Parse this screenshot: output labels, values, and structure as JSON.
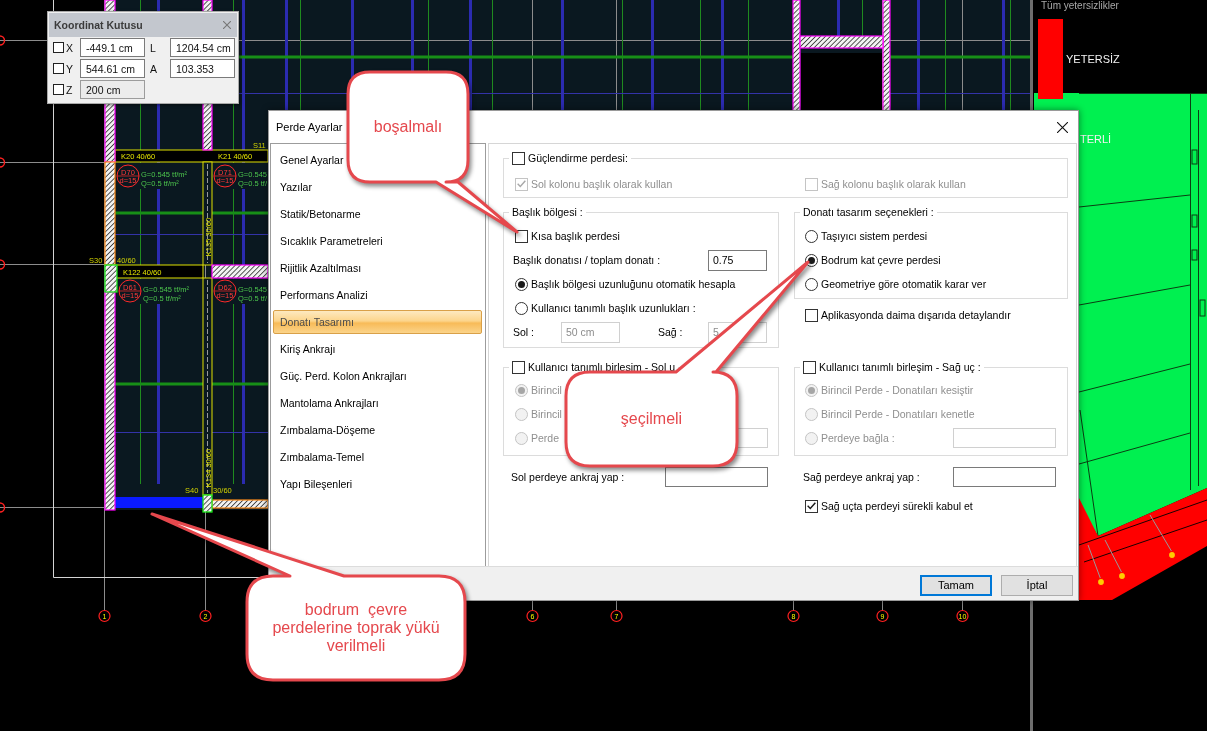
{
  "floor_plan": {
    "labels": [
      {
        "kind": "tag",
        "text": "S11"
      },
      {
        "kind": "beam",
        "text": "K20  40/60"
      },
      {
        "kind": "beam",
        "text": "K21  40/60"
      },
      {
        "kind": "load",
        "text": "G=0.545 tf/m²"
      },
      {
        "kind": "load",
        "text": "Q=0.5 tf/m²"
      },
      {
        "kind": "load",
        "text": "G=0.545"
      },
      {
        "kind": "load",
        "text": "Q=0.5 tf/"
      },
      {
        "kind": "vertical",
        "text": "K135  30/60"
      },
      {
        "kind": "tag",
        "text": "S30"
      },
      {
        "kind": "tag",
        "text": "40/60"
      },
      {
        "kind": "beam",
        "text": "K122  40/60"
      },
      {
        "kind": "load",
        "text": "G=0.545 tf/m²"
      },
      {
        "kind": "load",
        "text": "Q=0.5 tf/m²"
      },
      {
        "kind": "load",
        "text": "G=0.545"
      },
      {
        "kind": "load",
        "text": "Q=0.5 tf/"
      },
      {
        "kind": "vertical",
        "text": "K134  30/60"
      },
      {
        "kind": "tag",
        "text": "S40"
      },
      {
        "kind": "tag",
        "text": "30/60"
      }
    ],
    "slabs": [
      {
        "name": "D70",
        "thickness": "d=15"
      },
      {
        "name": "D71",
        "thickness": "d=15"
      },
      {
        "name": "D61",
        "thickness": "d=15"
      },
      {
        "name": "D62",
        "thickness": "d=15"
      }
    ],
    "axes": [
      "1",
      "2",
      "6",
      "7",
      "8",
      "9",
      "10"
    ]
  },
  "result_view": {
    "title": "Tüm yetersizlikler",
    "legend": [
      {
        "label": "YETERSİZ",
        "color": "#ff0000"
      },
      {
        "label": "TERLİ"
      }
    ]
  },
  "coordinate_box": {
    "title": "Koordinat Kutusu",
    "rows": [
      {
        "axis": "X",
        "checked": false,
        "value": "-449.1 cm",
        "disabled": false,
        "extra_label": "L",
        "extra_value": "1204.54 cm"
      },
      {
        "axis": "Y",
        "checked": false,
        "value": "544.61 cm",
        "disabled": false,
        "extra_label": "A",
        "extra_value": "103.353"
      },
      {
        "axis": "Z",
        "checked": false,
        "value": "200 cm",
        "disabled": true
      }
    ]
  },
  "dialog": {
    "title": "Perde Ayarlar",
    "nav": [
      {
        "label": "Genel Ayarlar",
        "selected": false
      },
      {
        "label": "Yazılar",
        "selected": false
      },
      {
        "label": "Statik/Betonarme",
        "selected": false
      },
      {
        "label": "Sıcaklık Parametreleri",
        "selected": false
      },
      {
        "label": "Rijitlik Azaltılması",
        "selected": false
      },
      {
        "label": "Performans Analizi",
        "selected": false
      },
      {
        "label": "Donatı Tasarımı",
        "selected": true
      },
      {
        "label": "Kiriş Ankrajı",
        "selected": false
      },
      {
        "label": "Güç. Perd. Kolon Ankrajları",
        "selected": false
      },
      {
        "label": "Mantolama Ankrajları",
        "selected": false
      },
      {
        "label": "Zımbalama-Döşeme",
        "selected": false
      },
      {
        "label": "Zımbalama-Temel",
        "selected": false
      },
      {
        "label": "Yapı Bileşenleri",
        "selected": false
      }
    ],
    "reinforcement": {
      "label": "Güçlendirme perdesi:",
      "checked": false,
      "options": [
        {
          "label": "Sol kolonu başlık olarak kullan",
          "checked": true,
          "disabled": true
        },
        {
          "label": "Sağ kolonu başlık olarak kullan",
          "checked": false,
          "disabled": true
        }
      ]
    },
    "header_zone": {
      "title": "Başlık bölgesi :",
      "short_header": {
        "label": "Kısa başlık perdesi",
        "checked": false
      },
      "ratio": {
        "label": "Başlık donatısı / toplam donatı :",
        "value": "0.75"
      },
      "modes": [
        {
          "label": "Başlık bölgesi uzunluğunu otomatik hesapla",
          "selected": true
        },
        {
          "label": "Kullanıcı tanımlı başlık uzunlukları :",
          "selected": false
        }
      ],
      "lengths": [
        {
          "label": "Sol :",
          "value": "50 cm",
          "disabled": true
        },
        {
          "label": "Sağ :",
          "value": "5",
          "disabled": true
        }
      ]
    },
    "design_options": {
      "title": "Donatı tasarım seçenekleri :",
      "options": [
        {
          "label": "Taşıyıcı sistem perdesi",
          "selected": false
        },
        {
          "label": "Bodrum kat çevre perdesi",
          "selected": true
        },
        {
          "label": "Geometriye göre otomatik karar ver",
          "selected": false
        }
      ]
    },
    "detail_outside": {
      "label": "Aplikasyonda daima dışarıda detaylandır",
      "checked": false
    },
    "joints": [
      {
        "label": "Kullanıcı tanımlı birleşim - Sol u",
        "checked": false,
        "options": [
          {
            "kind": "radio",
            "label": "Birincil",
            "selected": true,
            "disabled": true
          },
          {
            "kind": "radio",
            "label": "Birincil",
            "selected": false,
            "disabled": true
          },
          {
            "kind": "radio-field",
            "label": "Perde",
            "selected": false,
            "disabled": true
          }
        ]
      },
      {
        "label": "Kullanıcı tanımlı birleşim - Sağ uç :",
        "checked": false,
        "options": [
          {
            "kind": "radio",
            "label": "Birincil Perde - Donatıları kesiştir",
            "selected": true,
            "disabled": true
          },
          {
            "kind": "radio",
            "label": "Birincil Perde - Donatıları kenetle",
            "selected": false,
            "disabled": true
          },
          {
            "kind": "radio-field",
            "label": "Perdeye bağla :",
            "selected": false,
            "disabled": true
          }
        ]
      }
    ],
    "anchors": [
      {
        "label": "Sol perdeye ankraj yap :"
      },
      {
        "label": "Sağ perdeye ankraj yap :"
      }
    ],
    "continuous": {
      "label": "Sağ uçta perdeyi sürekli kabul et",
      "checked": true
    },
    "buttons": [
      {
        "label": "Tamam",
        "focused": true
      },
      {
        "label": "İptal",
        "focused": false
      }
    ]
  },
  "annotations": [
    {
      "text": "boşalmalı"
    },
    {
      "text": "şeçilmeli"
    },
    {
      "text": "bodrum  çevre perdelerine toprak yükü verilmeli"
    }
  ]
}
